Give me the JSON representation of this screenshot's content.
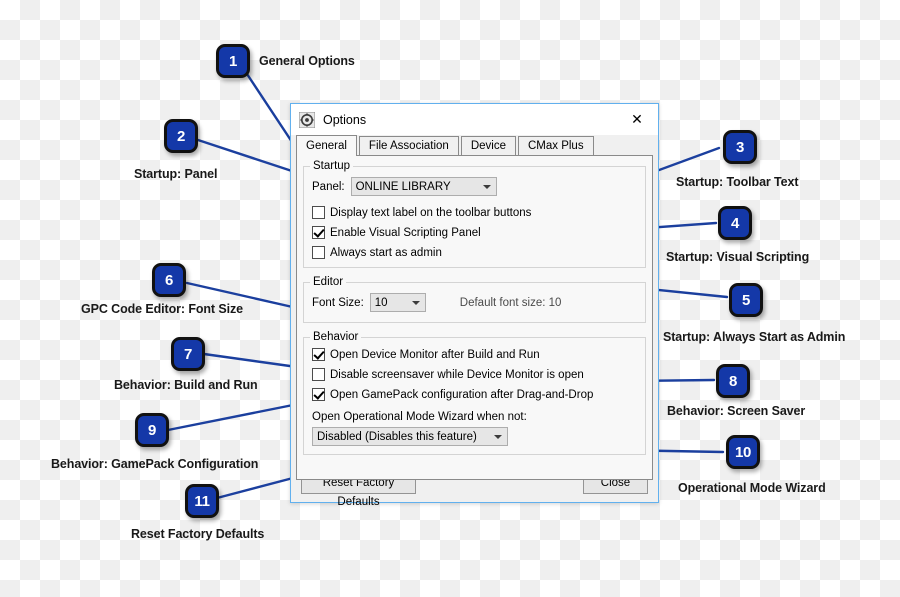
{
  "dialog": {
    "title": "Options",
    "app_icon": "gear-icon",
    "close_icon": "✕",
    "tabs": [
      {
        "label": "General",
        "active": true
      },
      {
        "label": "File Association",
        "active": false
      },
      {
        "label": "Device",
        "active": false
      },
      {
        "label": "CMax Plus",
        "active": false
      }
    ],
    "startup_group": {
      "title": "Startup",
      "panel_label": "Panel:",
      "panel_value": "ONLINE LIBRARY",
      "checkboxes": [
        {
          "label": "Display text label on the toolbar buttons",
          "checked": false
        },
        {
          "label": "Enable Visual Scripting Panel",
          "checked": true
        },
        {
          "label": "Always start as admin",
          "checked": false
        }
      ]
    },
    "editor_group": {
      "title": "Editor",
      "font_size_label": "Font Size:",
      "font_size_value": "10",
      "default_font_note": "Default font size: 10"
    },
    "behavior_group": {
      "title": "Behavior",
      "checkboxes": [
        {
          "label": "Open Device Monitor after Build and Run",
          "checked": true
        },
        {
          "label": "Disable screensaver while Device Monitor is open",
          "checked": false
        },
        {
          "label": "Open GamePack configuration after Drag-and-Drop",
          "checked": true
        }
      ],
      "wizard_label": "Open Operational Mode Wizard when not:",
      "wizard_value": "Disabled (Disables this feature)"
    },
    "footer": {
      "reset_label": "Reset Factory Defaults",
      "close_label": "Close"
    }
  },
  "annotations": {
    "badge_color": "#1438a8",
    "line_color": "#1b3f9e",
    "items": [
      {
        "number": "1",
        "label": "General Options"
      },
      {
        "number": "2",
        "label": "Startup: Panel"
      },
      {
        "number": "3",
        "label": "Startup: Toolbar Text"
      },
      {
        "number": "4",
        "label": "Startup: Visual Scripting"
      },
      {
        "number": "5",
        "label": "Startup: Always Start as Admin"
      },
      {
        "number": "6",
        "label": "GPC Code Editor: Font Size"
      },
      {
        "number": "7",
        "label": "Behavior: Build and Run"
      },
      {
        "number": "8",
        "label": "Behavior: Screen Saver"
      },
      {
        "number": "9",
        "label": "Behavior: GamePack Configuration"
      },
      {
        "number": "10",
        "label": "Operational Mode Wizard"
      },
      {
        "number": "11",
        "label": "Reset Factory Defaults"
      }
    ]
  }
}
